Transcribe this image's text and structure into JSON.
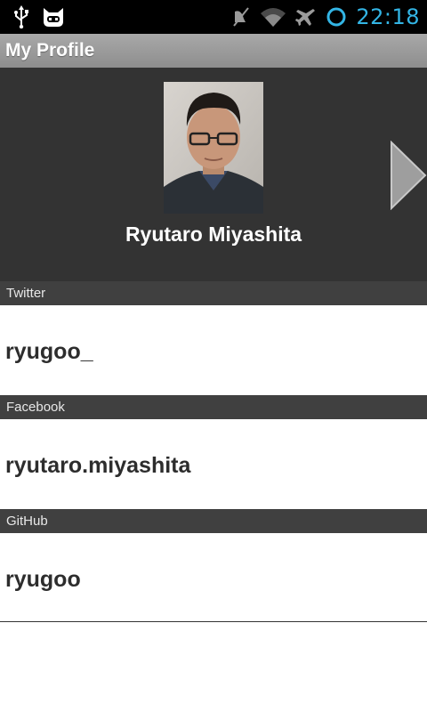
{
  "status_bar": {
    "time": "22:18",
    "icons": [
      "usb-icon",
      "cyanogenmod-icon",
      "mute-icon",
      "wifi-icon",
      "airplane-icon",
      "sync-icon"
    ],
    "clock_color": "#33b5e5"
  },
  "title_bar": {
    "title": "My Profile"
  },
  "profile": {
    "name": "Ryutaro Miyashita"
  },
  "sections": [
    {
      "label": "Twitter",
      "value": "ryugoo_"
    },
    {
      "label": "Facebook",
      "value": "ryutaro.miyashita"
    },
    {
      "label": "GitHub",
      "value": "ryugoo"
    }
  ],
  "colors": {
    "section_header_bg": "#404040",
    "header_bg": "#333333",
    "accent": "#33b5e5"
  }
}
